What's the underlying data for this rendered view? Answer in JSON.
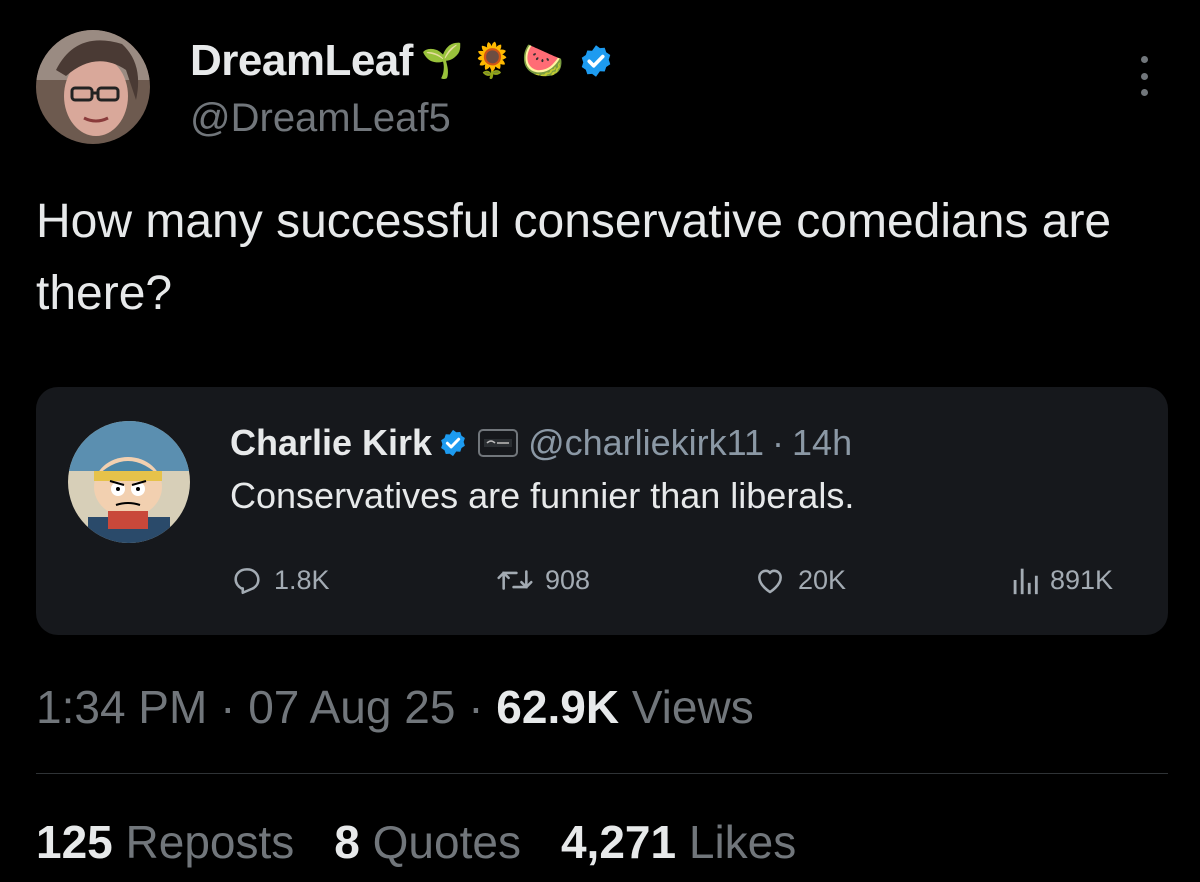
{
  "author": {
    "display_name": "DreamLeaf",
    "handle": "@DreamLeaf5",
    "name_emojis": [
      "🌱",
      "🌻",
      "🍉"
    ],
    "verified": true
  },
  "tweet": {
    "text": "How many successful conservative comedians are there?"
  },
  "quoted": {
    "display_name": "Charlie Kirk",
    "handle": "@charliekirk11",
    "separator": "·",
    "time_ago": "14h",
    "text": "Conservatives are funnier than liberals.",
    "verified": true,
    "stats": {
      "replies": "1.8K",
      "reposts": "908",
      "likes": "20K",
      "views": "891K"
    }
  },
  "meta": {
    "time": "1:34 PM",
    "separator": "·",
    "date": "07 Aug 25",
    "views_count": "62.9K",
    "views_label": "Views"
  },
  "engagement": {
    "reposts_count": "125",
    "reposts_label": "Reposts",
    "quotes_count": "8",
    "quotes_label": "Quotes",
    "likes_count": "4,271",
    "likes_label": "Likes"
  },
  "colors": {
    "background": "#000000",
    "card": "#16181c",
    "text_primary": "#e7e9ea",
    "text_secondary": "#71767b",
    "verified_blue": "#1d9bf0"
  },
  "icons": [
    "more-icon",
    "verified-badge-icon",
    "affiliate-badge-icon",
    "reply-icon",
    "repost-icon",
    "like-icon",
    "views-icon"
  ]
}
